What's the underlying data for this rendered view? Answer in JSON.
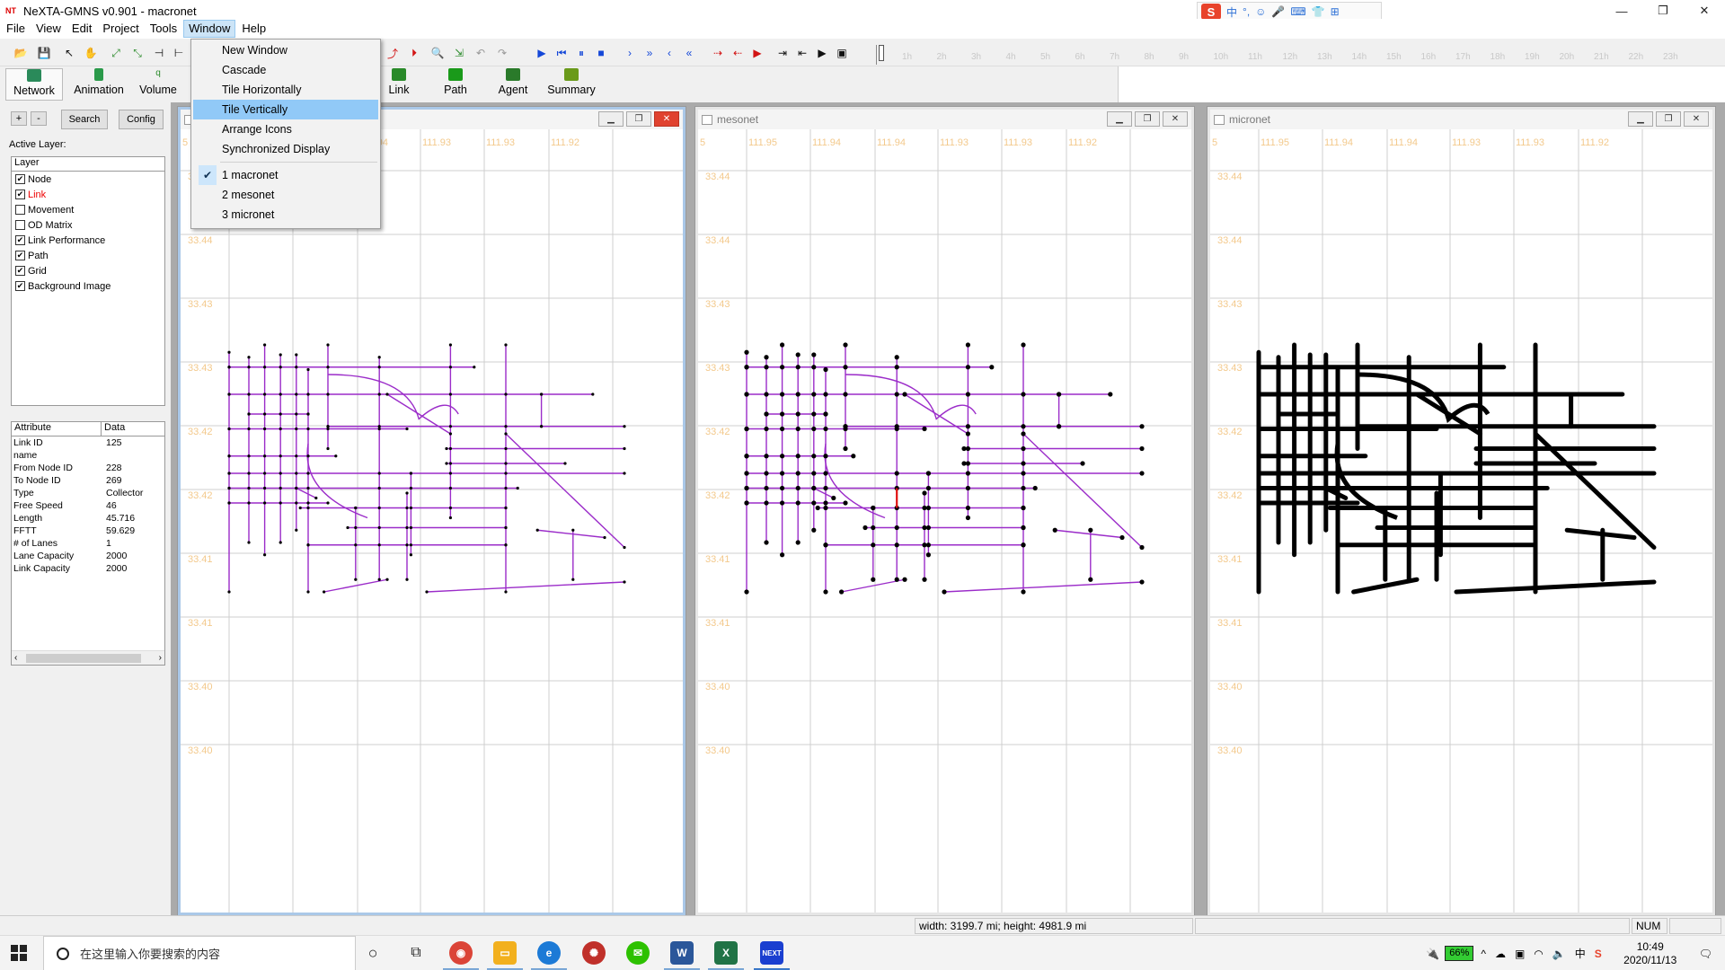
{
  "app": {
    "title": "NeXTA-GMNS v0.901 - macronet",
    "icon_text": "NT",
    "window_controls": {
      "minimize": "—",
      "maximize": "❐",
      "close": "✕"
    }
  },
  "ime": {
    "logo": "S",
    "items": [
      "中",
      "°,",
      "☺",
      "🎤",
      "⌨",
      "👕",
      "⊞"
    ]
  },
  "menubar": [
    "File",
    "View",
    "Edit",
    "Project",
    "Tools",
    "Window",
    "Help"
  ],
  "menubar_active": "Window",
  "window_menu": {
    "items": [
      "New Window",
      "Cascade",
      "Tile Horizontally",
      "Tile Vertically",
      "Arrange Icons",
      "Synchronized Display"
    ],
    "highlighted": "Tile Vertically",
    "windows": [
      "1 macronet",
      "2 mesonet",
      "3 micronet"
    ],
    "checked": "1 macronet"
  },
  "timeline": {
    "ticks": [
      "1h",
      "2h",
      "3h",
      "4h",
      "5h",
      "6h",
      "7h",
      "8h",
      "9h",
      "10h",
      "11h",
      "12h",
      "13h",
      "14h",
      "15h",
      "16h",
      "17h",
      "18h",
      "19h",
      "20h",
      "21h",
      "22h",
      "23h"
    ]
  },
  "modes": {
    "left": [
      "Network",
      "Animation",
      "Volume"
    ],
    "right": [
      "Link",
      "Path",
      "Agent",
      "Summary"
    ],
    "selected": "Network"
  },
  "left_panel": {
    "zoom_in": "+",
    "zoom_out": "-",
    "search_label": "Search",
    "config_label": "Config",
    "active_layer_label": "Active Layer:",
    "layer_header": "Layer",
    "layers": [
      {
        "name": "Node",
        "checked": true,
        "active": false
      },
      {
        "name": "Link",
        "checked": true,
        "active": true
      },
      {
        "name": "Movement",
        "checked": false,
        "active": false
      },
      {
        "name": "OD Matrix",
        "checked": false,
        "active": false
      },
      {
        "name": "Link Performance",
        "checked": true,
        "active": false
      },
      {
        "name": "Path",
        "checked": true,
        "active": false
      },
      {
        "name": "Grid",
        "checked": true,
        "active": false
      },
      {
        "name": "Background Image",
        "checked": true,
        "active": false
      }
    ],
    "attr_header": [
      "Attribute",
      "Data"
    ],
    "attributes": [
      [
        "Link ID",
        "125"
      ],
      [
        "name",
        ""
      ],
      [
        "From Node ID",
        "228"
      ],
      [
        "To Node ID",
        "269"
      ],
      [
        "Type",
        "Collector"
      ],
      [
        "Free Speed",
        " 46"
      ],
      [
        "Length",
        "45.716"
      ],
      [
        "FFTT",
        "59.629"
      ],
      [
        "# of Lanes",
        "1"
      ],
      [
        "Lane Capacity",
        "2000"
      ],
      [
        "Link Capacity",
        "2000"
      ]
    ]
  },
  "windows": [
    {
      "title": "macronet",
      "x_labels": [
        "5",
        "111.95",
        "111.94",
        "111.94",
        "111.93",
        "111.93",
        "111.92"
      ],
      "y_labels": [
        "33.44",
        "33.44",
        "33.43",
        "33.43",
        "33.42",
        "33.42",
        "33.41",
        "33.41",
        "33.40",
        "33.40"
      ],
      "style": "purple"
    },
    {
      "title": "mesonet",
      "x_labels": [
        "5",
        "111.95",
        "111.94",
        "111.94",
        "111.93",
        "111.93",
        "111.92"
      ],
      "y_labels": [
        "33.44",
        "33.44",
        "33.43",
        "33.43",
        "33.42",
        "33.42",
        "33.41",
        "33.41",
        "33.40",
        "33.40"
      ],
      "style": "purple-nodes"
    },
    {
      "title": "micronet",
      "x_labels": [
        "5",
        "111.95",
        "111.94",
        "111.94",
        "111.93",
        "111.93",
        "111.92"
      ],
      "y_labels": [
        "33.44",
        "33.44",
        "33.43",
        "33.43",
        "33.42",
        "33.42",
        "33.41",
        "33.41",
        "33.40",
        "33.40"
      ],
      "style": "black"
    }
  ],
  "status": {
    "size_text": "width: 3199.7 mi; height: 4981.9 mi",
    "num": "NUM"
  },
  "taskbar": {
    "search_placeholder": "在这里输入你要搜索的内容",
    "battery": "66%",
    "time": "10:49",
    "date": "2020/11/13"
  },
  "colors": {
    "purple_link": "#9b2cc9",
    "highlight_link": "#e01010",
    "grid_label": "#f3c98c"
  }
}
